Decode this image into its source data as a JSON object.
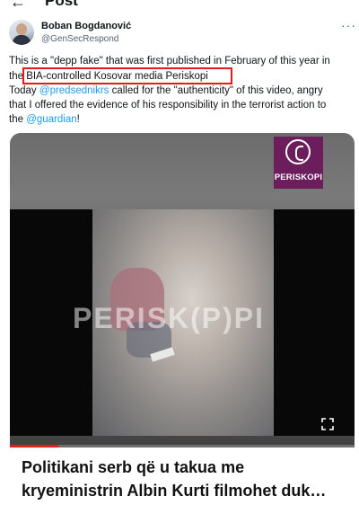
{
  "header": {
    "title": "Post"
  },
  "author": {
    "name": "Boban Bogdanović",
    "handle": "@GenSecRespond"
  },
  "tweet": {
    "line1": "This is a \"depp fake\" that was first published in February of this year in",
    "line2_prefix": "the ",
    "line2_highlight": "BIA-controlled Kosovar media Periskopi",
    "line3_prefix": "Today ",
    "line3_mention": "@predsednikrs",
    "line3_rest": " called for the \"authenticity\" of this video, angry",
    "line4": "that I offered the evidence of his responsibility in the terrorist action to",
    "line5_prefix": "the ",
    "line5_mention": "@guardian",
    "line5_suffix": "!"
  },
  "media": {
    "logo_text": "PERISKOPI",
    "watermark": "PERISK(P)PI",
    "progress_fraction": 0.14,
    "headline_line1": "Politikani serb që u takua me",
    "headline_line2": "kryeministrin Albin Kurti filmohet duk…"
  },
  "colors": {
    "link": "#1d9bf0",
    "highlight_border": "#e21b1b",
    "logo_bg": "#6b1d5c",
    "progress": "#e0201e"
  }
}
